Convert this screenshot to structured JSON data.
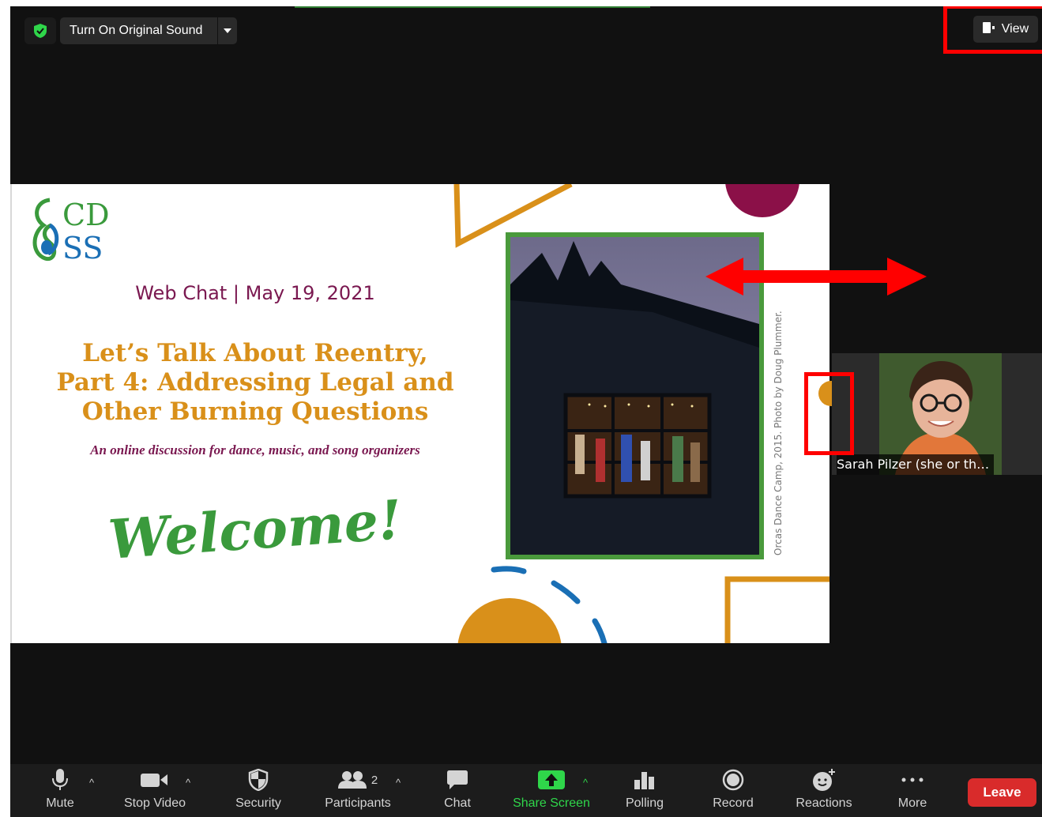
{
  "meeting": {
    "original_sound_label": "Turn On Original Sound",
    "view_label": "View"
  },
  "slide": {
    "logo_text_top": "CD",
    "logo_text_bottom": "SS",
    "subtitle": "Web Chat | May 19, 2021",
    "headline_lines": [
      "Let’s Talk About Reentry,",
      "Part 4: Addressing Legal and",
      "Other Burning Questions"
    ],
    "tagline": "An online discussion for dance, music, and song organizers",
    "welcome": "Welcome!",
    "photo_credit": "Orcas Dance Camp, 2015. Photo by Doug Plummer."
  },
  "participant_tile": {
    "name": "Sarah Pilzer (she or th…"
  },
  "toolbar": {
    "mute": "Mute",
    "stop_video": "Stop Video",
    "security": "Security",
    "participants": "Participants",
    "participants_count": "2",
    "chat": "Chat",
    "share_screen": "Share Screen",
    "polling": "Polling",
    "record": "Record",
    "reactions": "Reactions",
    "more": "More",
    "leave": "Leave"
  },
  "colors": {
    "slide_accent_orange": "#d9901a",
    "slide_maroon": "#7a1850",
    "slide_green": "#3a9a3c",
    "share_green": "#2fd64a",
    "leave_red": "#d92b2b",
    "annotation_red": "#ff0000"
  }
}
